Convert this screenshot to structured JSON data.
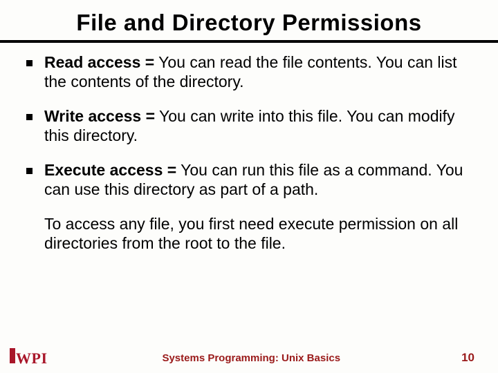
{
  "title": "File and Directory Permissions",
  "bullets": [
    {
      "term": "Read access =",
      "body": " You can read the file contents. You can list the contents of the directory."
    },
    {
      "term": "Write access =",
      "body": " You can write into this file. You can modify this directory."
    },
    {
      "term": "Execute access =",
      "body": " You can run this file as a command. You can use this directory as part of a path."
    }
  ],
  "closing": "To access any file, you first need execute permission on all directories from the root to the file.",
  "footer": {
    "logo_text": "WPI",
    "course": "Systems Programming:  Unix Basics",
    "page": "10"
  }
}
